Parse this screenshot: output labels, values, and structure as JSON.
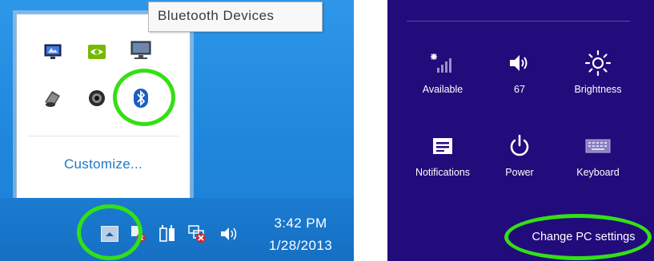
{
  "tray_popup": {
    "customize_label": "Customize...",
    "icons": [
      "network-monitor-icon",
      "nvidia-icon",
      "display-icon",
      "speaker-device-icon",
      "webcam-icon",
      "bluetooth-icon"
    ]
  },
  "tooltip": {
    "text": "Bluetooth Devices"
  },
  "taskbar": {
    "time": "3:42 PM",
    "date": "1/28/2013",
    "icons": [
      "show-hidden-icons-chevron",
      "action-center-warning-icon",
      "power-plug-icon",
      "network-error-icon",
      "volume-icon"
    ]
  },
  "quick_settings": {
    "items": [
      {
        "icon": "signal-icon",
        "label": "Available"
      },
      {
        "icon": "volume-icon",
        "label": "67"
      },
      {
        "icon": "brightness-icon",
        "label": "Brightness"
      },
      {
        "icon": "notifications-icon",
        "label": "Notifications"
      },
      {
        "icon": "power-icon",
        "label": "Power"
      },
      {
        "icon": "keyboard-icon",
        "label": "Keyboard"
      }
    ],
    "change_settings_label": "Change PC settings"
  },
  "colors": {
    "taskbar_blue": "#1a7bd0",
    "charm_purple": "#220b7b",
    "highlight_green": "#33e014",
    "link_blue": "#1e79c8"
  }
}
